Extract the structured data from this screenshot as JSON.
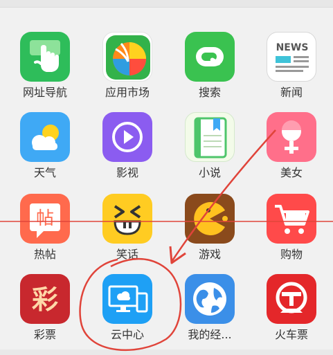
{
  "apps": [
    {
      "label": "网址导航",
      "icon": "hand-pointer-icon",
      "color": "#2ebd5a"
    },
    {
      "label": "应用市场",
      "icon": "app-store-ball-icon",
      "color": "#ffffff"
    },
    {
      "label": "搜索",
      "icon": "search-icon",
      "color": "#3ac250"
    },
    {
      "label": "新闻",
      "icon": "news-icon",
      "color": "#ffffff"
    },
    {
      "label": "天气",
      "icon": "weather-icon",
      "color": "#3fa9f5"
    },
    {
      "label": "影视",
      "icon": "play-icon",
      "color": "#8b5cf0"
    },
    {
      "label": "小说",
      "icon": "book-icon",
      "color": "#f3fbe9"
    },
    {
      "label": "美女",
      "icon": "female-icon",
      "color": "#ff6f8a"
    },
    {
      "label": "热帖",
      "icon": "post-icon",
      "color": "#ff6a4d"
    },
    {
      "label": "笑话",
      "icon": "laugh-face-icon",
      "color": "#ffcc22"
    },
    {
      "label": "游戏",
      "icon": "pacman-icon",
      "color": "#8a4a1c"
    },
    {
      "label": "购物",
      "icon": "shopping-cart-icon",
      "color": "#ff4a4a"
    },
    {
      "label": "彩票",
      "icon": "lottery-icon",
      "color": "#c8282e"
    },
    {
      "label": "云中心",
      "icon": "cloud-devices-icon",
      "color": "#1ea0f5"
    },
    {
      "label": "我的经...",
      "icon": "globe-icon",
      "color": "#3b8fe8"
    },
    {
      "label": "火车票",
      "icon": "train-logo-icon",
      "color": "#e4272a"
    }
  ],
  "news_icon_text": "NEWS",
  "post_icon_text": "帖",
  "lottery_icon_text": "彩",
  "annotation_color": "#e0443a"
}
